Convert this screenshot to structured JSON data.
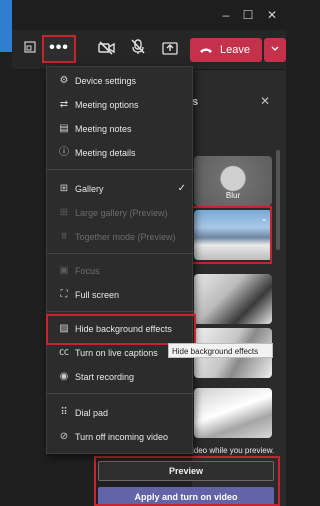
{
  "window": {
    "minimize": "–",
    "maximize": "☐",
    "close": "✕"
  },
  "toolbar": {
    "more_label": "•••",
    "leave_label": "Leave",
    "icons": [
      "share-screen-icon",
      "camera-off-icon",
      "mic-off-icon",
      "share-tray-icon"
    ]
  },
  "menu": {
    "items": [
      {
        "label": "Device settings",
        "icon": "gear-icon",
        "enabled": true
      },
      {
        "label": "Meeting options",
        "icon": "sliders-icon",
        "enabled": true
      },
      {
        "label": "Meeting notes",
        "icon": "notes-icon",
        "enabled": true
      },
      {
        "label": "Meeting details",
        "icon": "info-icon",
        "enabled": true
      },
      {
        "label": "Gallery",
        "icon": "gallery-icon",
        "enabled": true,
        "checked": true
      },
      {
        "label": "Large gallery (Preview)",
        "icon": "large-gallery-icon",
        "enabled": false
      },
      {
        "label": "Together mode (Preview)",
        "icon": "together-mode-icon",
        "enabled": false
      },
      {
        "label": "Focus",
        "icon": "focus-icon",
        "enabled": false
      },
      {
        "label": "Full screen",
        "icon": "fullscreen-icon",
        "enabled": true
      },
      {
        "label": "Hide background effects",
        "icon": "background-effects-icon",
        "enabled": true
      },
      {
        "label": "Turn on live captions",
        "icon": "captions-icon",
        "enabled": true
      },
      {
        "label": "Start recording",
        "icon": "record-icon",
        "enabled": true
      },
      {
        "label": "Dial pad",
        "icon": "dialpad-icon",
        "enabled": true
      },
      {
        "label": "Turn off incoming video",
        "icon": "incoming-video-off-icon",
        "enabled": true
      }
    ]
  },
  "tooltip": "Hide background effects",
  "background_panel": {
    "title_fragment": "s",
    "blur_label": "Blur",
    "note": "ideo while you preview.",
    "preview_label": "Preview",
    "apply_label": "Apply and turn on video"
  },
  "colors": {
    "highlight": "#c4262e",
    "leave": "#c4314b",
    "apply": "#6264a7",
    "accent": "#2f7fd0"
  }
}
